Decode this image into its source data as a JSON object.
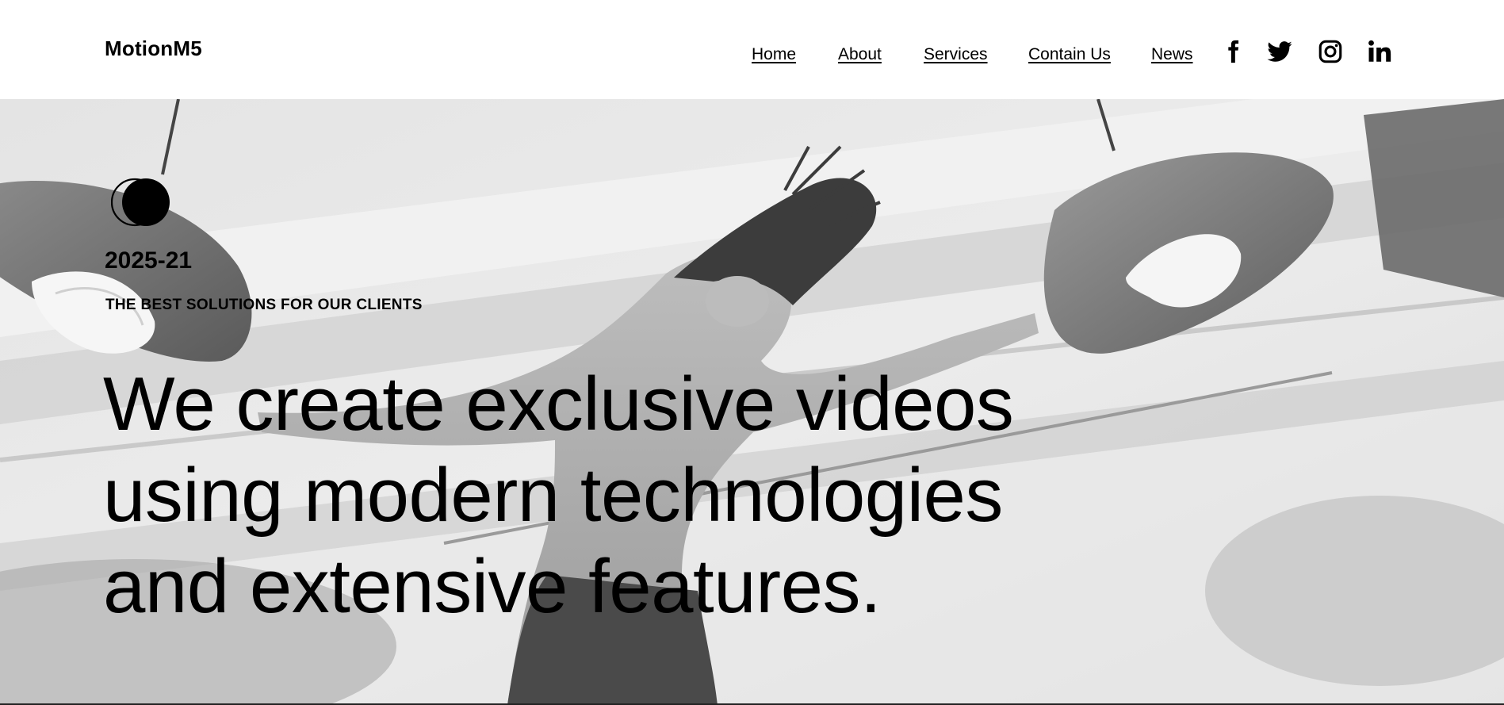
{
  "header": {
    "logo": "MotionM5",
    "nav": [
      {
        "label": "Home"
      },
      {
        "label": "About"
      },
      {
        "label": "Services"
      },
      {
        "label": "Contain Us"
      },
      {
        "label": "News"
      }
    ],
    "social": [
      {
        "icon": "facebook-icon"
      },
      {
        "icon": "twitter-icon"
      },
      {
        "icon": "instagram-icon"
      },
      {
        "icon": "linkedin-icon"
      }
    ]
  },
  "hero": {
    "year": "2025-21",
    "tagline": "THE BEST SOLUTIONS FOR OUR CLIENTS",
    "headline_lines": [
      "We create exclusive videos",
      "using modern technologies",
      "and extensive features."
    ],
    "background": "grayscale photo of a dancer leaping with arms spread beneath two hanging dome lamps"
  },
  "colors": {
    "text": "#000000",
    "header_bg": "#ffffff",
    "hero_tint": "#d9d9d9"
  }
}
